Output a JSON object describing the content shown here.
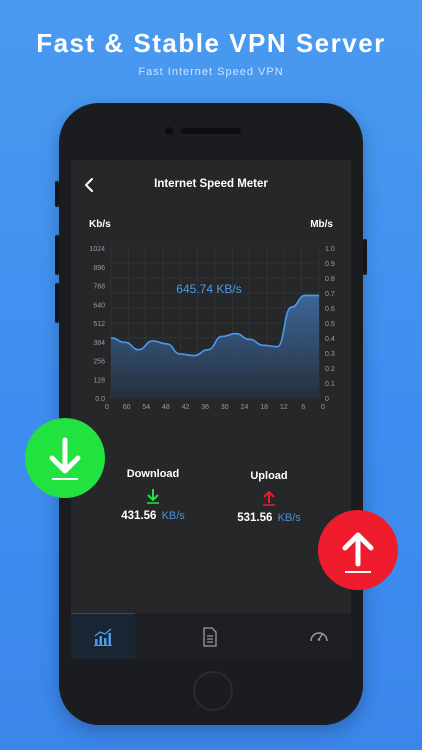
{
  "promo": {
    "headline": "Fast & Stable VPN Server",
    "subline": "Fast Internet Speed VPN"
  },
  "screen": {
    "title": "Internet Speed Meter",
    "left_unit": "Kb/s",
    "right_unit": "Mb/s"
  },
  "chart_data": {
    "type": "area",
    "current_label": "645.74 KB/s",
    "y_left_ticks": [
      "1024",
      "896",
      "768",
      "640",
      "512",
      "384",
      "256",
      "128",
      "0.0"
    ],
    "y_right_ticks": [
      "1.0",
      "0.9",
      "0.8",
      "0.7",
      "0.6",
      "0.5",
      "0.4",
      "0.3",
      "0.2",
      "0.1",
      "0"
    ],
    "x_ticks": [
      "0",
      "60",
      "54",
      "48",
      "42",
      "36",
      "30",
      "24",
      "18",
      "12",
      "6",
      "0"
    ],
    "ylim": [
      0,
      1024
    ],
    "values": [
      410,
      380,
      330,
      390,
      370,
      300,
      290,
      330,
      420,
      440,
      400,
      360,
      350,
      620,
      700,
      700
    ],
    "colors": {
      "line": "#4a9af0",
      "fill_top": "#3d6a9e",
      "fill_bottom": "#26303d",
      "grid": "#3a3b3f"
    }
  },
  "stats": {
    "download_label": "Download",
    "download_value": "431.56",
    "download_unit": "KB/s",
    "upload_label": "Upload",
    "upload_value": "531.56",
    "upload_unit": "KB/s"
  },
  "colors": {
    "download": "#21e23f",
    "upload": "#ef1c2d",
    "accent": "#4a9af0"
  },
  "icons": {
    "tab1": "chart-icon",
    "tab2": "document-icon",
    "tab3": "speedometer-icon"
  }
}
